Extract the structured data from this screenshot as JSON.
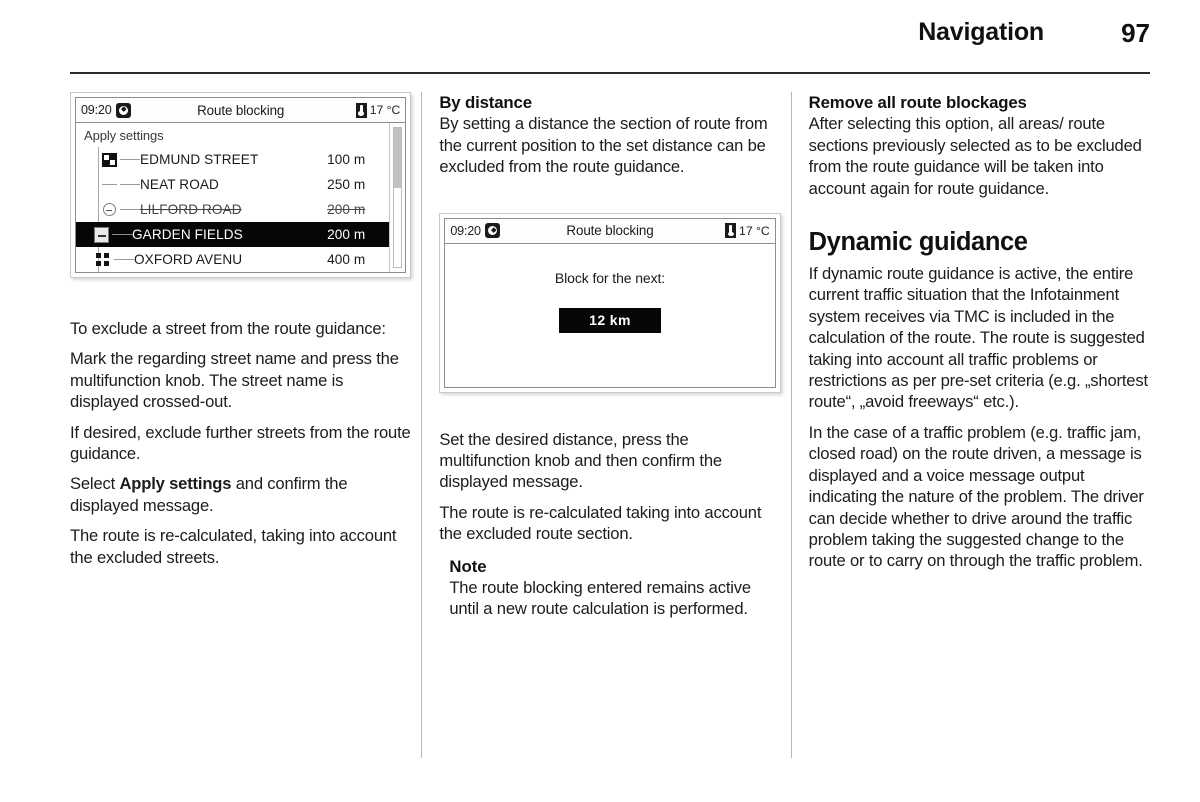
{
  "header": {
    "title": "Navigation",
    "page_number": "97"
  },
  "left_column": {
    "screenshot": {
      "name": "route-blocking-list-screen",
      "status_bar": {
        "time": "09:20",
        "clock_icon": "clock-icon",
        "title": "Route blocking",
        "temp_icon": "thermometer-icon",
        "temperature": "17 °C"
      },
      "apply_settings_label": "Apply settings",
      "rows": [
        {
          "icon": "flag-icon",
          "name": "EDMUND STREET",
          "distance": "100 m",
          "selected": false,
          "struck": false
        },
        {
          "icon": "line-icon",
          "name": "NEAT ROAD",
          "distance": "250 m",
          "selected": false,
          "struck": false
        },
        {
          "icon": "circle-minus-icon",
          "name": "LILFORD ROAD",
          "distance": "200 m",
          "selected": false,
          "struck": true
        },
        {
          "icon": "box-minus-icon",
          "name": "GARDEN FIELDS",
          "distance": "200 m",
          "selected": true,
          "struck": false
        },
        {
          "icon": "grid-icon",
          "name": "OXFORD AVENU",
          "distance": "400 m",
          "selected": false,
          "struck": false
        }
      ]
    },
    "paragraphs": [
      "To exclude a street from the route guidance:",
      "Mark the regarding street name and press the multifunction knob. The street name is displayed crossed-out.",
      "If desired, exclude further streets from the route guidance.",
      "The route is re-calculated, taking into account the excluded streets."
    ],
    "select_paragraph": {
      "before": "Select ",
      "bold": "Apply settings",
      "after": " and confirm the displayed message."
    }
  },
  "middle_column": {
    "heading": "By distance",
    "intro": "By setting a distance the section of route from the current position to the set distance can be excluded from the route guidance.",
    "screenshot": {
      "name": "route-blocking-distance-screen",
      "status_bar": {
        "time": "09:20",
        "clock_icon": "clock-icon",
        "title": "Route blocking",
        "temp_icon": "thermometer-icon",
        "temperature": "17 °C"
      },
      "prompt": "Block for the next:",
      "value": "12 km"
    },
    "paragraphs": [
      "Set the desired distance, press the multifunction knob and then confirm the displayed message.",
      "The route is re-calculated taking into account the excluded route section."
    ],
    "note": {
      "title": "Note",
      "text": "The route blocking entered remains active until a new route calculation is performed."
    }
  },
  "right_column": {
    "heading": "Remove all route blockages",
    "intro": "After selecting this option, all areas/ route sections previously selected as to be excluded from the route guidance will be taken into account again for route guidance.",
    "section_title": "Dynamic guidance",
    "paragraphs": [
      "If dynamic route guidance is active, the entire current traffic situation that the Infotainment system receives via TMC is included in the calculation of the route. The route is suggested taking into account all traffic problems or restrictions as per pre-set criteria (e.g. „shortest route“, „avoid freeways“ etc.).",
      "In the case of a traffic problem (e.g. traffic jam, closed road) on the route driven, a message is displayed and a voice message output indicating the nature of the problem. The driver can decide whether to drive around the traffic problem taking the suggested change to the route or to carry on through the traffic problem."
    ]
  },
  "colors": {
    "text": "#1c1c1c",
    "rule": "#2a2a2a",
    "divider": "#b7b7b7",
    "selection_bg": "#060606"
  }
}
